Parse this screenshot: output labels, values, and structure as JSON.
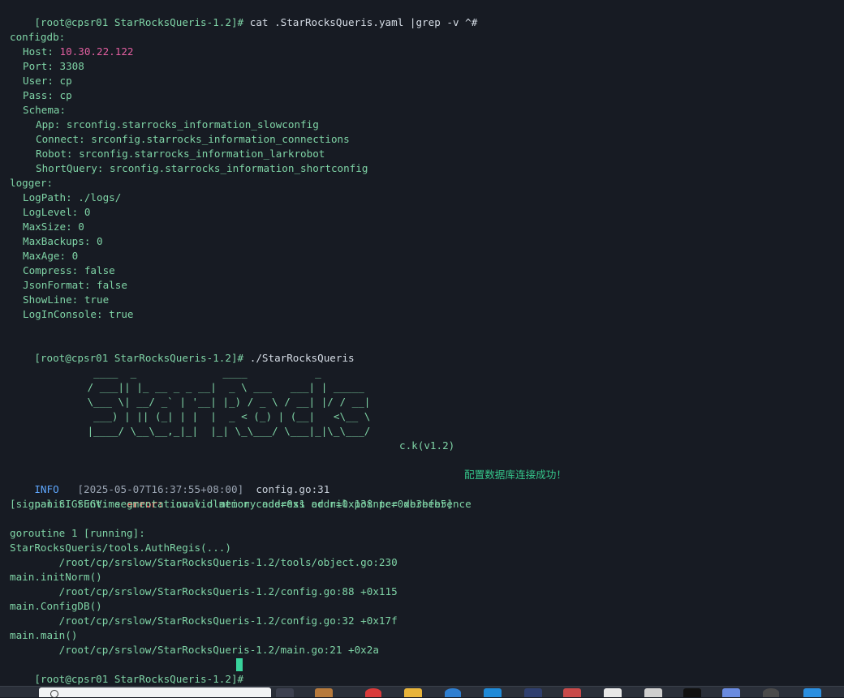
{
  "terminal": {
    "prompt": "[root@cpsr01 StarRocksQueris-1.2]#",
    "cmd1": "cat .StarRocksQueris.yaml |grep -v ^#",
    "config": {
      "configdb_key": "configdb:",
      "host_key": "Host:",
      "host_val": "10.30.22.122",
      "port": "Port: 3308",
      "user": "User: cp",
      "pass": "Pass: cp",
      "schema": "Schema:",
      "app": "App: srconfig.starrocks_information_slowconfig",
      "connect": "Connect: srconfig.starrocks_information_connections",
      "robot": "Robot: srconfig.starrocks_information_larkrobot",
      "shortquery": "ShortQuery: srconfig.starrocks_information_shortconfig",
      "logger": "logger:",
      "logpath": "LogPath: ./logs/",
      "loglevel": "LogLevel: 0",
      "maxsize": "MaxSize: 0",
      "maxbackups": "MaxBackups: 0",
      "maxage": "MaxAge: 0",
      "compress": "Compress: false",
      "jsonformat": "JsonFormat: false",
      "showline": "ShowLine: true",
      "loginconsole": "LogInConsole: true"
    },
    "cmd2": "./StarRocksQueris",
    "banner": "  ____  _              ____           _\n / ___|| |_ __ _ _ __|  _ \\ ___   ___| | _____\n \\___ \\| __/ _` | '__| |_) / _ \\ / __| |/ / __|\n  ___) | || (_| | |  |  _ < (_) | (__|   <\\__ \\\n |____/ \\__\\__,_|_|  |_| \\_\\___/ \\___|_|\\_\\___/",
    "version": "c.k(v1.2)",
    "log": {
      "level": "INFO",
      "timestamp": "[2025-05-07T16:37:55+08:00]",
      "source": "config.go:31",
      "message": "配置数据库连接成功！"
    },
    "panic_prefix": "panic: runtime",
    "panic_error": "error:",
    "panic_msg": "invalid memory address or nil pointer dereference",
    "signal": "[signal SIGSEGV: segmentation violation code=0x1 addr=0x138 pc=0xb3beb5]",
    "goroutine": "goroutine 1 [running]:",
    "trace": [
      "StarRocksQueris/tools.AuthRegis(...)",
      "        /root/cp/srslow/StarRocksQueris-1.2/tools/object.go:230",
      "main.initNorm()",
      "        /root/cp/srslow/StarRocksQueris-1.2/config.go:88 +0x115",
      "main.ConfigDB()",
      "        /root/cp/srslow/StarRocksQueris-1.2/config.go:32 +0x17f",
      "main.main()",
      "        /root/cp/srslow/StarRocksQueris-1.2/main.go:21 +0x2a"
    ]
  },
  "colors": {
    "background": "#171b23",
    "prompt": "#7fd4a6",
    "accent_number": "#e25fa0",
    "info": "#5fa8ff",
    "error": "#ff6a6a",
    "cursor": "#38d39b"
  },
  "taskbar": {
    "icons": [
      "search-icon",
      "app-icon",
      "app-icon",
      "chrome-icon",
      "folder-icon",
      "edge-icon",
      "store-icon",
      "vpn-icon",
      "app-icon",
      "notes-icon",
      "app-icon",
      "terminal-icon",
      "app-icon",
      "app-icon",
      "app-icon"
    ]
  }
}
